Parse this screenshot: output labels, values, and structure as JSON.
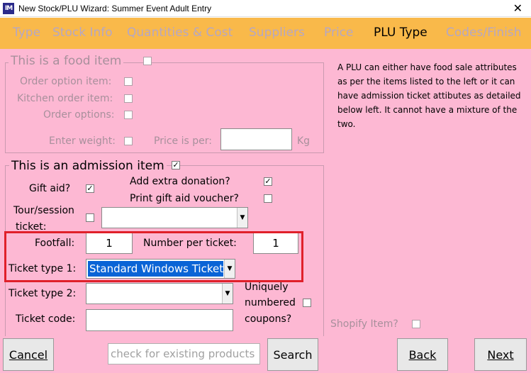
{
  "window": {
    "icon_text": "IM",
    "title": "New Stock/PLU Wizard: Summer Event Adult Entry",
    "close_glyph": "✕"
  },
  "tabs": [
    {
      "label": "Type",
      "active": false
    },
    {
      "label": "Stock Info",
      "active": false
    },
    {
      "label": "Quantities & Cost",
      "active": false
    },
    {
      "label": "Suppliers",
      "active": false
    },
    {
      "label": "Price",
      "active": false
    },
    {
      "label": "PLU Type",
      "active": true
    },
    {
      "label": "Codes/Finish",
      "active": false
    }
  ],
  "food": {
    "title": "This is a food item",
    "checked": false,
    "order_option_item": "Order option item:",
    "kitchen_order_item": "Kitchen order item:",
    "order_options": "Order options:",
    "enter_weight": "Enter weight:",
    "price_is_per": "Price is per:",
    "price_is_per_value": "",
    "unit": "Kg"
  },
  "admission": {
    "title": "This is an admission item",
    "checked": true,
    "gift_aid": "Gift aid?",
    "gift_aid_checked": true,
    "add_extra_donation": "Add extra donation?",
    "add_extra_donation_checked": true,
    "print_gift_aid_voucher": "Print gift aid voucher?",
    "print_gift_aid_voucher_checked": false,
    "tour_session_line1": "Tour/session",
    "tour_session_line2": "ticket:",
    "tour_session_checked": false,
    "tour_session_value": "",
    "footfall": "Footfall:",
    "footfall_value": "1",
    "number_per_ticket": "Number per ticket:",
    "number_per_ticket_value": "1",
    "ticket_type_1": "Ticket type 1:",
    "ticket_type_1_value": "Standard Windows Ticket",
    "ticket_type_2": "Ticket type 2:",
    "ticket_type_2_value": "",
    "ticket_code": "Ticket code:",
    "ticket_code_value": "",
    "uniquely_line1": "Uniquely",
    "uniquely_line2": "numbered",
    "uniquely_line3": "coupons?",
    "uniquely_checked": false
  },
  "info_text": "A PLU can either have food sale attributes as per the items listed to the left or it can have admission  ticket attibutes as detailed below left.  It cannot have a mixture of the two.",
  "shopify": {
    "label": "Shopify Item?",
    "checked": false
  },
  "bottom": {
    "cancel": "Cancel",
    "search_placeholder": "check for existing products",
    "search": "Search",
    "back": "Back",
    "next": "Next"
  },
  "colors": {
    "tab_bar": "#f9b94a",
    "panel": "#fdb8d3",
    "highlight_box": "#e0202a",
    "selection": "#0a64d6"
  }
}
